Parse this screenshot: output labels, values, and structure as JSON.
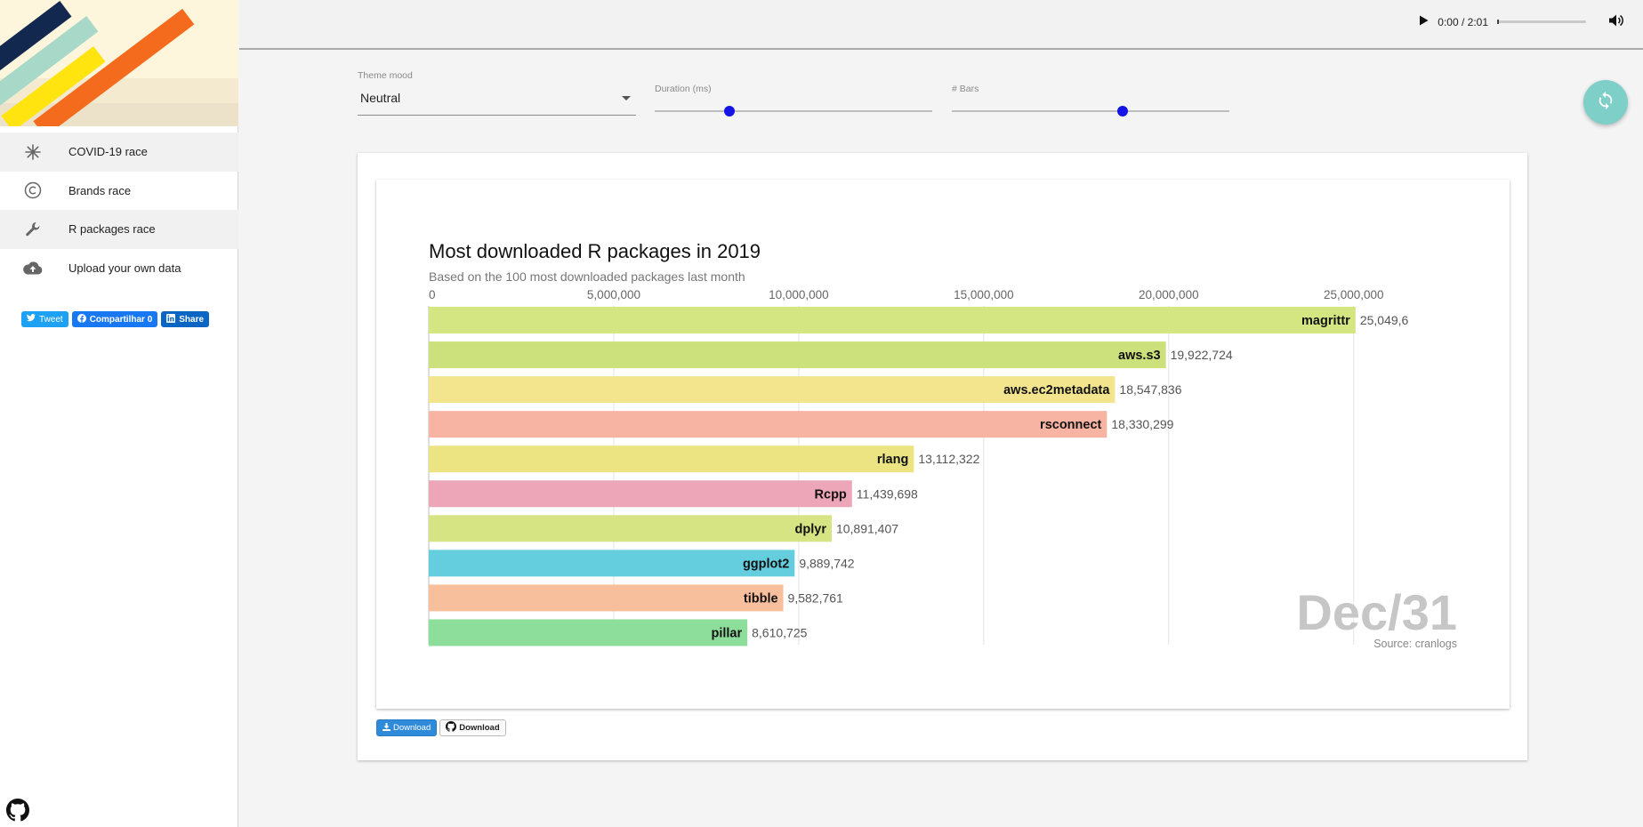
{
  "sidebar": {
    "items": [
      {
        "label": "COVID-19 race",
        "icon": "snowflake-icon"
      },
      {
        "label": "Brands race",
        "icon": "copyright-icon"
      },
      {
        "label": "R packages race",
        "icon": "wrench-icon"
      },
      {
        "label": "Upload your own data",
        "icon": "cloud-upload-icon"
      }
    ],
    "share": {
      "tweet": "Tweet",
      "facebook": "Compartilhar 0",
      "linkedin": "Share"
    }
  },
  "audio": {
    "time": "0:00 / 2:01"
  },
  "controls": {
    "theme_label": "Theme mood",
    "theme_value": "Neutral",
    "duration_label": "Duration (ms)",
    "bars_label": "# Bars"
  },
  "buttons": {
    "download_label": "Download",
    "github_download_label": "Download"
  },
  "chart_data": {
    "type": "bar",
    "orientation": "horizontal",
    "title": "Most downloaded R packages in 2019",
    "subtitle": "Based on the 100 most downloaded packages last month",
    "date_label": "Dec/31",
    "source": "Source: cranlogs",
    "xlim": [
      0,
      26400000
    ],
    "x_ticks": [
      0,
      5000000,
      10000000,
      15000000,
      20000000,
      25000000
    ],
    "x_tick_labels": [
      "0",
      "5,000,000",
      "10,000,000",
      "15,000,000",
      "20,000,000",
      "25,000,000"
    ],
    "grid": true,
    "categories": [
      "magrittr",
      "aws.s3",
      "aws.ec2metadata",
      "rsconnect",
      "rlang",
      "Rcpp",
      "dplyr",
      "ggplot2",
      "tibble",
      "pillar"
    ],
    "values": [
      25049600,
      19922724,
      18547836,
      18330299,
      13112322,
      11439698,
      10891407,
      9889742,
      9582761,
      8610725
    ],
    "value_labels": [
      "25,049,6",
      "19,922,724",
      "18,547,836",
      "18,330,299",
      "13,112,322",
      "11,439,698",
      "10,891,407",
      "9,889,742",
      "9,582,761",
      "8,610,725"
    ],
    "colors": [
      "#d4e682",
      "#cce17c",
      "#f2e58e",
      "#f8b4a3",
      "#ece483",
      "#eca6b8",
      "#d6e484",
      "#65cede",
      "#f8bf9c",
      "#8ede9b"
    ]
  }
}
